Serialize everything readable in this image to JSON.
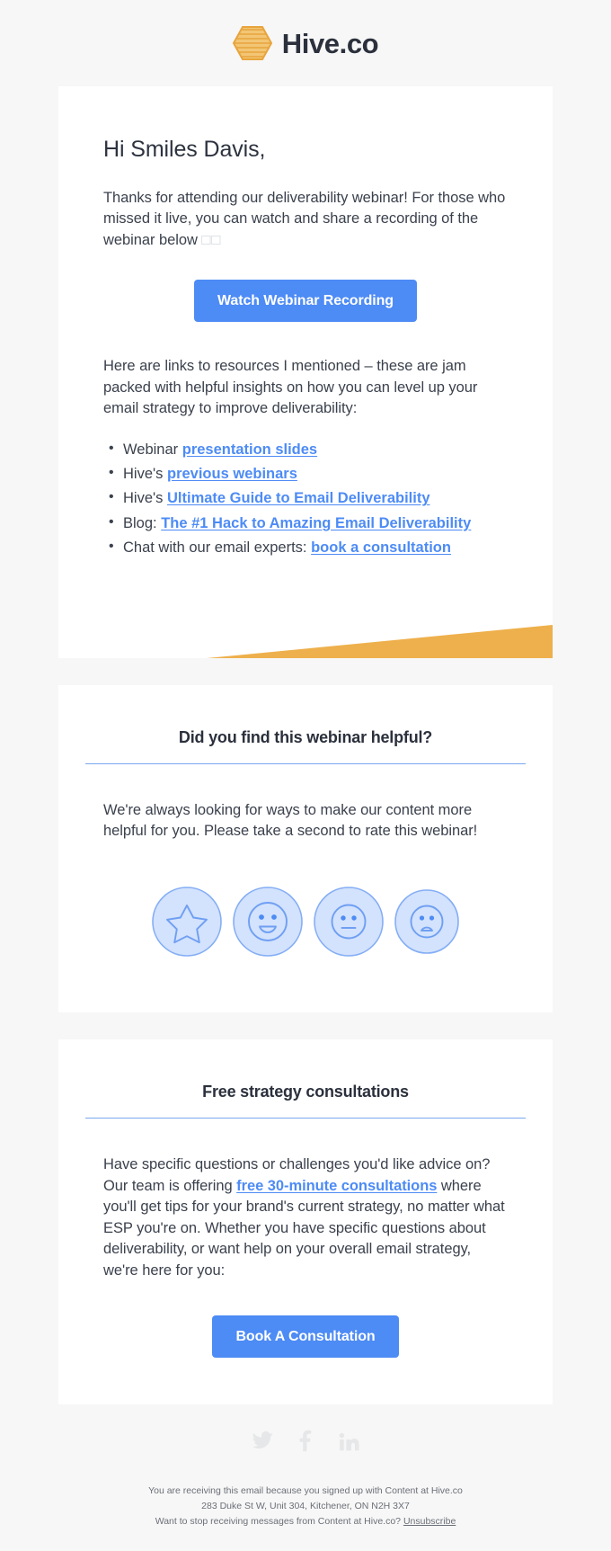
{
  "brand": {
    "logo_text": "Hive.co",
    "logo_icon": "hive-logo-icon",
    "amber": "#eeb04c",
    "accent_blue": "#4d8bf5",
    "ink": "#2b303c",
    "page_bg": "#f7f7f7"
  },
  "body": {
    "greeting": "Hi Smiles Davis,",
    "intro_text": "Thanks for attending our deliverability webinar! For those who missed it live, you can watch and share a recording of the webinar below ",
    "intro_emoji": "□□",
    "cta_watch_label": "Watch Webinar Recording",
    "resources_intro": "Here are links to resources I mentioned – these are jam packed with helpful insights on how you can level up your email strategy to improve deliverability:",
    "links": [
      {
        "prefix": "Webinar ",
        "link": "presentation slides",
        "suffix": ""
      },
      {
        "prefix": "Hive's ",
        "link": "previous webinars",
        "suffix": ""
      },
      {
        "prefix": "Hive's ",
        "link": "Ultimate Guide to Email Deliverability",
        "suffix": ""
      },
      {
        "prefix": "Blog: ",
        "link": "The #1 Hack to Amazing Email Deliverability",
        "suffix": ""
      },
      {
        "prefix": "Chat with our email experts: ",
        "link": "book a consultation",
        "suffix": ""
      }
    ]
  },
  "feedback": {
    "heading": "Did you find this webinar helpful?",
    "text": "We're always looking for ways to make our content more helpful for you. Please take a second to rate this webinar!",
    "options": [
      {
        "name": "rating-star",
        "icon": "star-icon"
      },
      {
        "name": "rating-happy",
        "icon": "happy-face-icon"
      },
      {
        "name": "rating-neutral",
        "icon": "neutral-face-icon"
      },
      {
        "name": "rating-sad",
        "icon": "sad-face-icon"
      }
    ]
  },
  "consultations": {
    "heading": "Free strategy consultations",
    "para_1": "Have specific questions or challenges you'd like advice on? Our team is offering ",
    "para_link": "free 30-minute consultations",
    "para_2": " where you'll get tips for your brand's current strategy, no matter what ESP you're on. Whether you have specific questions about deliverability, or want help on your overall email strategy, we're here for you:",
    "cta_label": "Book A Consultation"
  },
  "footer": {
    "socials": [
      {
        "name": "twitter-icon",
        "label": "Twitter"
      },
      {
        "name": "facebook-icon",
        "label": "Facebook"
      },
      {
        "name": "linkedin-icon",
        "label": "LinkedIn"
      }
    ],
    "line_1": "You are receiving this email because you signed up with Content at Hive.co",
    "line_2": "283 Duke St W, Unit 304, Kitchener, ON N2H 3X7",
    "line_3_prefix": "Want to stop receiving messages from Content at Hive.co? ",
    "unsubscribe_label": "Unsubscribe"
  }
}
